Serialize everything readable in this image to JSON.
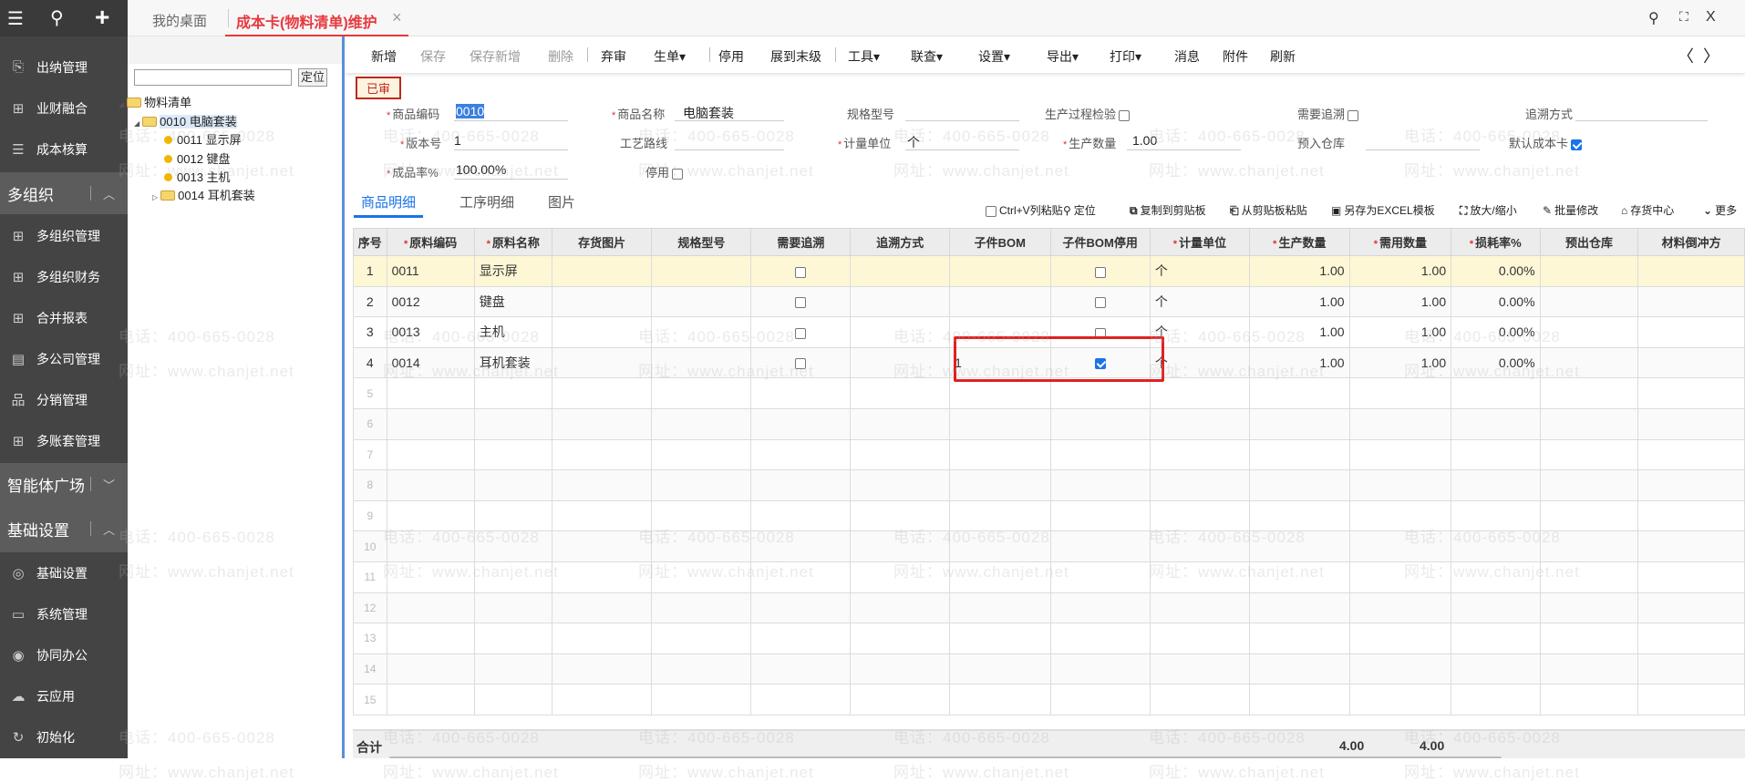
{
  "sidebar": {
    "top_icons": [
      "menu-icon",
      "search-icon",
      "plus-icon"
    ],
    "items": [
      {
        "label": "出纳管理",
        "icon": "cashier-icon"
      },
      {
        "label": "业财融合",
        "icon": "grid-icon"
      },
      {
        "label": "成本核算",
        "icon": "list-check-icon"
      }
    ],
    "groups": [
      {
        "label": "多组织",
        "expanded": true,
        "items": [
          {
            "label": "多组织管理"
          },
          {
            "label": "多组织财务"
          },
          {
            "label": "合并报表"
          },
          {
            "label": "多公司管理"
          },
          {
            "label": "分销管理"
          },
          {
            "label": "多账套管理"
          }
        ]
      },
      {
        "label": "智能体广场",
        "expanded": false,
        "items": []
      },
      {
        "label": "基础设置",
        "expanded": true,
        "items": [
          {
            "label": "基础设置"
          },
          {
            "label": "系统管理"
          },
          {
            "label": "协同办公"
          },
          {
            "label": "云应用"
          },
          {
            "label": "初始化"
          }
        ]
      }
    ]
  },
  "tabs": [
    {
      "label": "我的桌面",
      "active": false
    },
    {
      "label": "成本卡(物料清单)维护",
      "active": true,
      "closable": "×"
    }
  ],
  "window_controls": {
    "search": "⚲",
    "expand": "⛶",
    "close": "X"
  },
  "tree": {
    "locate_button": "定位",
    "search_value": "",
    "nodes": [
      {
        "label": "物料清单",
        "level": 0,
        "type": "folder-open"
      },
      {
        "label": "0010 电脑套装",
        "level": 1,
        "type": "folder-open",
        "selected": true
      },
      {
        "label": "0011 显示屏",
        "level": 2,
        "type": "leaf"
      },
      {
        "label": "0012 键盘",
        "level": 2,
        "type": "leaf"
      },
      {
        "label": "0013 主机",
        "level": 2,
        "type": "leaf"
      },
      {
        "label": "0014 耳机套装",
        "level": 1,
        "type": "folder-closed"
      }
    ]
  },
  "toolbar": {
    "items": [
      {
        "label": "新增",
        "disabled": false
      },
      {
        "label": "保存",
        "disabled": true
      },
      {
        "label": "保存新增",
        "disabled": true
      },
      {
        "label": "删除",
        "disabled": true
      },
      {
        "label": "弃审"
      },
      {
        "label": "生单▾"
      },
      {
        "label": "停用"
      },
      {
        "label": "展到末级"
      },
      {
        "label": "工具▾"
      },
      {
        "label": "联查▾"
      },
      {
        "label": "设置▾"
      },
      {
        "label": "导出▾"
      },
      {
        "label": "打印▾"
      },
      {
        "label": "消息"
      },
      {
        "label": "附件"
      },
      {
        "label": "刷新"
      }
    ],
    "prev": "〈",
    "next": "〉"
  },
  "status_badge": "已审",
  "form": {
    "product_code": {
      "label": "商品编码",
      "value": "0010"
    },
    "product_name": {
      "label": "商品名称",
      "value": "电脑套装"
    },
    "spec": {
      "label": "规格型号",
      "value": ""
    },
    "process_check": {
      "label": "生产过程检验",
      "checked": false
    },
    "need_trace": {
      "label": "需要追溯",
      "checked": false
    },
    "trace_method": {
      "label": "追溯方式",
      "value": ""
    },
    "version": {
      "label": "版本号",
      "value": "1"
    },
    "route": {
      "label": "工艺路线",
      "value": ""
    },
    "unit": {
      "label": "计量单位",
      "value": "个"
    },
    "prod_qty": {
      "label": "生产数量",
      "value": "1.00"
    },
    "warehouse_in": {
      "label": "预入仓库",
      "value": ""
    },
    "default_card": {
      "label": "默认成本卡",
      "checked": true
    },
    "yield": {
      "label": "成品率%",
      "value": "100.00%"
    },
    "disabled": {
      "label": "停用",
      "checked": false
    }
  },
  "detail_tabs": [
    {
      "label": "商品明细",
      "active": true
    },
    {
      "label": "工序明细"
    },
    {
      "label": "图片"
    }
  ],
  "grid_tools": {
    "ctrlv": "Ctrl+V列粘贴",
    "locate": "定位",
    "copy": "复制到剪贴板",
    "paste": "从剪贴板粘贴",
    "save_excel": "另存为EXCEL模板",
    "zoom": "放大/缩小",
    "batch": "批量修改",
    "inventory": "存货中心",
    "more": "更多"
  },
  "grid": {
    "columns": [
      {
        "label": "序号"
      },
      {
        "label": "原料编码",
        "req": true
      },
      {
        "label": "原料名称",
        "req": true
      },
      {
        "label": "存货图片"
      },
      {
        "label": "规格型号"
      },
      {
        "label": "需要追溯"
      },
      {
        "label": "追溯方式"
      },
      {
        "label": "子件BOM"
      },
      {
        "label": "子件BOM停用"
      },
      {
        "label": "计量单位",
        "req": true
      },
      {
        "label": "生产数量",
        "req": true
      },
      {
        "label": "需用数量",
        "req": true
      },
      {
        "label": "损耗率%",
        "req": true
      },
      {
        "label": "预出仓库"
      },
      {
        "label": "材料倒冲方"
      }
    ],
    "rows": [
      {
        "no": "1",
        "code": "0011",
        "name": "显示屏",
        "trace": false,
        "bom": "",
        "bom_disabled": false,
        "unit": "个",
        "prod_qty": "1.00",
        "need_qty": "1.00",
        "loss": "0.00%"
      },
      {
        "no": "2",
        "code": "0012",
        "name": "键盘",
        "trace": false,
        "bom": "",
        "bom_disabled": false,
        "unit": "个",
        "prod_qty": "1.00",
        "need_qty": "1.00",
        "loss": "0.00%"
      },
      {
        "no": "3",
        "code": "0013",
        "name": "主机",
        "trace": false,
        "bom": "",
        "bom_disabled": false,
        "unit": "个",
        "prod_qty": "1.00",
        "need_qty": "1.00",
        "loss": "0.00%"
      },
      {
        "no": "4",
        "code": "0014",
        "name": "耳机套装",
        "trace": false,
        "bom": "1",
        "bom_disabled": true,
        "unit": "个",
        "prod_qty": "1.00",
        "need_qty": "1.00",
        "loss": "0.00%"
      }
    ],
    "empty_rows": [
      "5",
      "6",
      "7",
      "8",
      "9",
      "10",
      "11",
      "12",
      "13",
      "14",
      "15"
    ],
    "total_label": "合计",
    "total_prod_qty": "4.00",
    "total_need_qty": "4.00"
  },
  "watermark": {
    "phone": "电话：400-665-0028",
    "site": "网址：www.chanjet.net"
  },
  "colors": {
    "accent": "#e8383d",
    "link": "#1a73e8",
    "highlight_box": "#e02020"
  }
}
